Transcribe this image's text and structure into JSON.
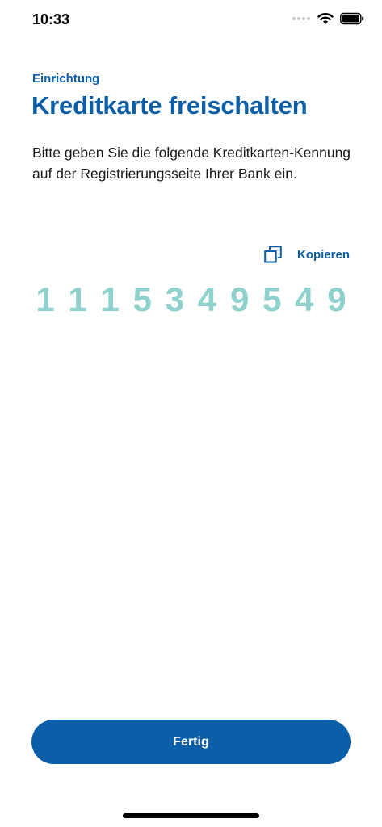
{
  "status_bar": {
    "time": "10:33"
  },
  "header": {
    "eyebrow": "Einrichtung",
    "title": "Kreditkarte freischalten"
  },
  "description": "Bitte geben Sie die folgende Kreditkarten-Kennung auf der Registrierungsseite Ihrer Bank ein.",
  "copy": {
    "label": "Kopieren",
    "icon": "copy-icon"
  },
  "card_id_digits": [
    "1",
    "1",
    "1",
    "5",
    "3",
    "4",
    "9",
    "5",
    "4",
    "9"
  ],
  "actions": {
    "done_label": "Fertig"
  },
  "colors": {
    "accent": "#0b5fa8",
    "id_digits": "#8ed1cd",
    "background": "#ffffff"
  }
}
